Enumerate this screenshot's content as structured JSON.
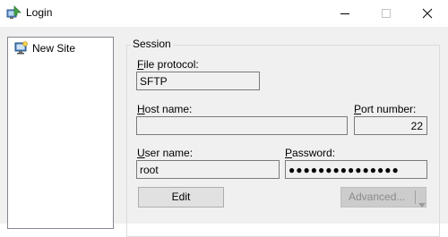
{
  "window": {
    "title": "Login",
    "icon": "winscp-login-icon",
    "controls": [
      "minimize-icon",
      "maximize-icon",
      "close-icon"
    ]
  },
  "site_tree": {
    "items": [
      {
        "label": "New Site",
        "icon": "new-site-computer-icon"
      }
    ]
  },
  "session": {
    "group_label": "Session",
    "file_protocol": {
      "label_first": "F",
      "label_rest": "ile protocol:",
      "value": "SFTP"
    },
    "host_name": {
      "label_first": "H",
      "label_rest": "ost name:",
      "value": ""
    },
    "port_number": {
      "label_first": "P",
      "label_rest": "ort number:",
      "value": "22"
    },
    "user_name": {
      "label_first": "U",
      "label_rest": "ser name:",
      "value": "root"
    },
    "password": {
      "label_first": "P",
      "label_rest": "assword:",
      "value": "●●●●●●●●●●●●●●●"
    },
    "edit_button": "Edit",
    "advanced_button": "Advanced...",
    "advanced_disabled": true
  },
  "colors": {
    "dialog_bg": "#f0f0f0",
    "field_border": "#7a7a7a",
    "disabled_text": "#8a8a8a"
  }
}
